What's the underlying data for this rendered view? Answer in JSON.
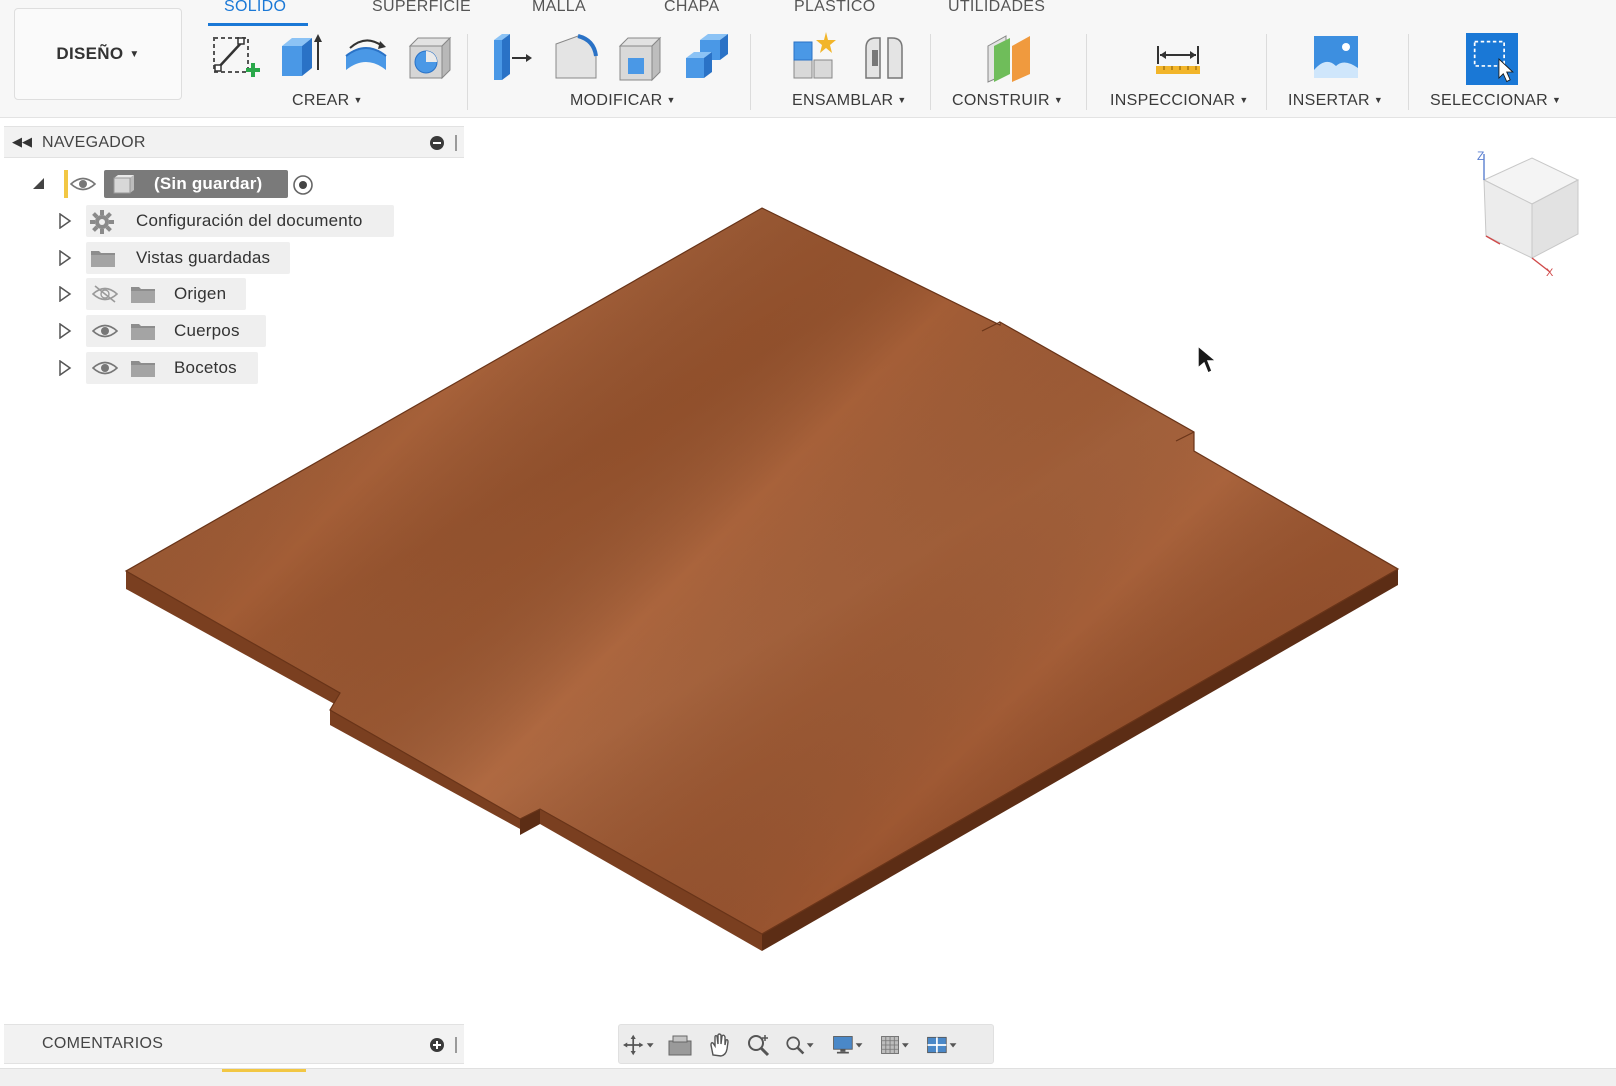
{
  "workspace": {
    "label": "DISEÑO"
  },
  "tabs": [
    {
      "label": "SOLIDO",
      "active": true
    },
    {
      "label": "SUPERFICIE",
      "active": false
    },
    {
      "label": "MALLA",
      "active": false
    },
    {
      "label": "CHAPA",
      "active": false
    },
    {
      "label": "PLÁSTICO",
      "active": false
    },
    {
      "label": "UTILIDADES",
      "active": false
    }
  ],
  "groups": {
    "crear": "CREAR",
    "modificar": "MODIFICAR",
    "ensamblar": "ENSAMBLAR",
    "construir": "CONSTRUIR",
    "inspeccionar": "INSPECCIONAR",
    "insertar": "INSERTAR",
    "seleccionar": "SELECCIONAR"
  },
  "navigator": {
    "title": "NAVEGADOR",
    "root": {
      "label": "(Sin guardar)"
    },
    "items": [
      {
        "label": "Configuración del documento",
        "icon": "gear-icon"
      },
      {
        "label": "Vistas guardadas",
        "icon": "folder-icon"
      },
      {
        "label": "Origen",
        "icon": "folder-icon",
        "visible": false
      },
      {
        "label": "Cuerpos",
        "icon": "folder-icon",
        "visible": true
      },
      {
        "label": "Bocetos",
        "icon": "folder-icon",
        "visible": true
      }
    ]
  },
  "viewcube": {
    "axes": [
      "Z",
      "X"
    ]
  },
  "comments": {
    "title": "COMENTARIOS"
  },
  "colors": {
    "accent": "#1a78d6",
    "wood_top": "#a8623c",
    "wood_edge": "#6e3a1e"
  }
}
